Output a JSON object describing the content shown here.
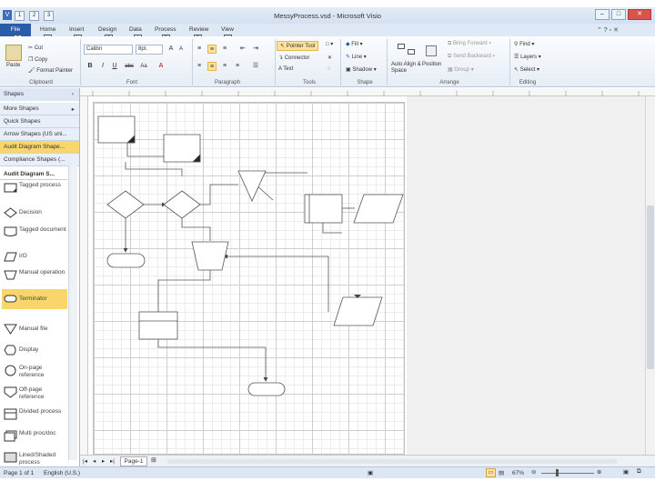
{
  "window": {
    "title": "MessyProcess.vsd - Microsoft Visio",
    "qat_keytips": [
      "1",
      "2",
      "3"
    ],
    "controls": {
      "minimize": "–",
      "maximize": "□",
      "close": "✕"
    }
  },
  "ribbon": {
    "tabs": [
      {
        "label": "File",
        "keytip": "F"
      },
      {
        "label": "Home",
        "keytip": "H"
      },
      {
        "label": "Insert",
        "keytip": "N"
      },
      {
        "label": "Design",
        "keytip": "G"
      },
      {
        "label": "Data",
        "keytip": "A"
      },
      {
        "label": "Process",
        "keytip": "P"
      },
      {
        "label": "Review",
        "keytip": "R"
      },
      {
        "label": "View",
        "keytip": "W"
      }
    ],
    "clipboard": {
      "paste": "Paste",
      "cut": "Cut",
      "copy": "Copy",
      "format_painter": "Format Painter",
      "label": "Clipboard"
    },
    "font": {
      "name": "Calibri",
      "size": "8pt.",
      "label": "Font"
    },
    "paragraph": {
      "label": "Paragraph"
    },
    "tools": {
      "pointer": "Pointer Tool",
      "connector": "Connector",
      "text": "Text",
      "label": "Tools"
    },
    "shape": {
      "fill": "Fill",
      "line": "Line",
      "shadow": "Shadow",
      "label": "Shape"
    },
    "arrange": {
      "auto_align": "Auto Align & Space",
      "position": "Position",
      "bring_forward": "Bring Forward",
      "send_backward": "Send Backward",
      "group": "Group",
      "label": "Arrange"
    },
    "editing": {
      "find": "Find",
      "layers": "Layers",
      "select": "Select",
      "label": "Editing"
    }
  },
  "shapes_pane": {
    "title": "Shapes",
    "stencils": [
      {
        "label": "More Shapes",
        "selected": false
      },
      {
        "label": "Quick Shapes",
        "selected": false
      },
      {
        "label": "Arrow Shapes (US uni...",
        "selected": false
      },
      {
        "label": "Audit Diagram Shape...",
        "selected": true
      },
      {
        "label": "Compliance Shapes (...",
        "selected": false
      }
    ],
    "section_title": "Audit Diagram S...",
    "masters": [
      {
        "label": "Tagged process",
        "icon": "tagged-process-icon"
      },
      {
        "label": "Decision",
        "icon": "decision-icon"
      },
      {
        "label": "Tagged document",
        "icon": "tagged-document-icon"
      },
      {
        "label": "I/O",
        "icon": "io-icon"
      },
      {
        "label": "Manual operation",
        "icon": "manual-operation-icon"
      },
      {
        "label": "Terminator",
        "icon": "terminator-icon",
        "selected": true
      },
      {
        "label": "Manual file",
        "icon": "manual-file-icon"
      },
      {
        "label": "Display",
        "icon": "display-icon"
      },
      {
        "label": "On-page reference",
        "icon": "on-page-reference-icon"
      },
      {
        "label": "Off-page reference",
        "icon": "off-page-reference-icon"
      },
      {
        "label": "Divided process",
        "icon": "divided-process-icon"
      },
      {
        "label": "Multi proc/doc",
        "icon": "multi-proc-doc-icon"
      },
      {
        "label": "Lined/Shaded process",
        "icon": "lined-shaded-process-icon"
      }
    ]
  },
  "page_tabs": {
    "active": "Page-1"
  },
  "status": {
    "page": "Page 1 of 1",
    "language": "English (U.S.)",
    "zoom": "67%"
  },
  "colors": {
    "accent": "#2a5caa",
    "highlight": "#f9d66b",
    "ribbon": "#e6edf6"
  }
}
